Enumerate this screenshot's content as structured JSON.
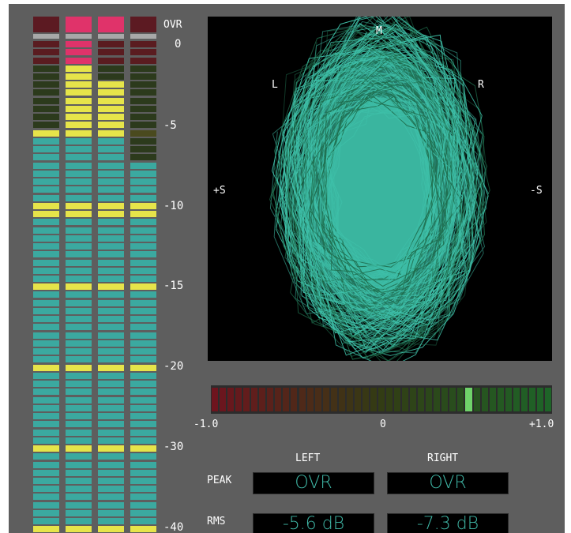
{
  "meter": {
    "ovr_label": "OVR",
    "scale_labels": [
      "0",
      "-5",
      "-10",
      "-15",
      "-20",
      "-30",
      "-40"
    ],
    "channels": 4,
    "ovr_lit": [
      false,
      true,
      true,
      false
    ],
    "levels_db": [
      -5.0,
      0.3,
      -2.0,
      -7.0
    ]
  },
  "goniometer": {
    "labels": {
      "top": "M",
      "left": "L",
      "right": "R",
      "far_left": "+S",
      "far_right": "-S"
    },
    "trace_color": "#3ebfa8"
  },
  "correlation": {
    "min_label": "-1.0",
    "mid_label": "0",
    "max_label": "+1.0",
    "value": 0.5
  },
  "readout": {
    "left_header": "LEFT",
    "right_header": "RIGHT",
    "peak_label": "PEAK",
    "rms_label": "RMS",
    "peak_left": "OVR",
    "peak_right": "OVR",
    "rms_left": "-5.6 dB",
    "rms_right": "-7.3 dB"
  },
  "colors": {
    "teal": "#3ba9a0",
    "yellow": "#e6e44a",
    "red": "#e0336a",
    "dim_red": "#5a1c20",
    "dim_green": "#2c3a1c",
    "background": "#5e5e5e"
  }
}
